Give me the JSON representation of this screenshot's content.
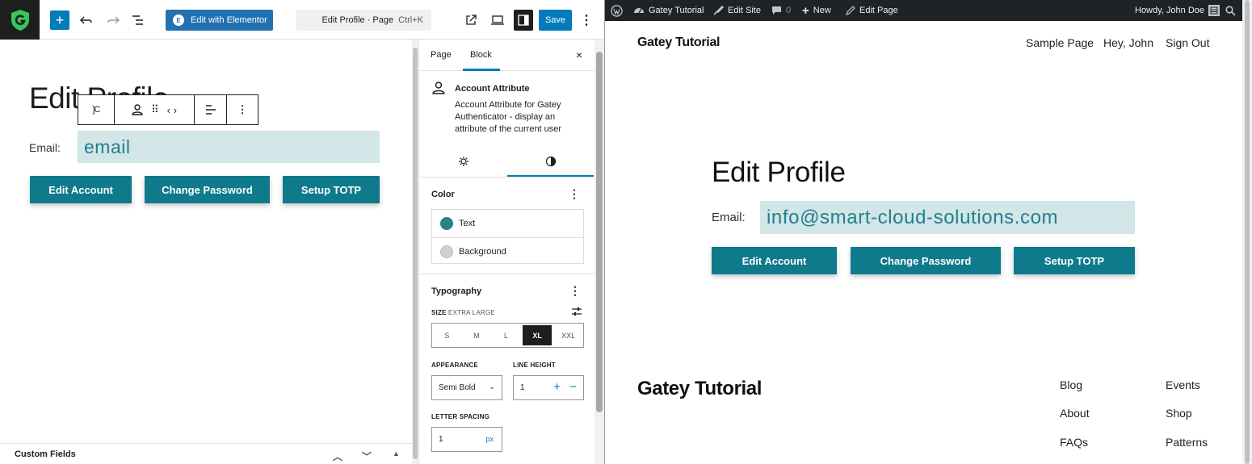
{
  "editor": {
    "toolbar": {
      "inserter_icon": "plus-icon",
      "undo_icon": "undo-icon",
      "redo_icon": "redo-icon",
      "list_view_icon": "list-view-icon",
      "elementor_badge": "E",
      "elementor_label": "Edit with Elementor",
      "command_label": "Edit Profile · Page",
      "command_shortcut": "Ctrl+K",
      "view_icon": "external-link-icon",
      "device_icon": "desktop-icon",
      "settings_icon": "sidebar-toggle-icon",
      "save_label": "Save",
      "options_icon": "kebab-icon"
    },
    "canvas": {
      "title": "Edit Profile",
      "email_label": "Email:",
      "email_value": "email",
      "buttons": [
        "Edit Account",
        "Change Password",
        "Setup TOTP"
      ]
    },
    "custom_fields_label": "Custom Fields"
  },
  "sidebar": {
    "tabs": [
      "Page",
      "Block"
    ],
    "active_tab": "Block",
    "close_label": "×",
    "block_card": {
      "title": "Account Attribute",
      "description": "Account Attribute for Gatey Authenticator - display an attribute of the current user"
    },
    "color": {
      "title": "Color",
      "items": [
        {
          "label": "Text",
          "color": "#2d7f8b"
        },
        {
          "label": "Background",
          "color": "#d0d0d0"
        }
      ]
    },
    "typography": {
      "title": "Typography",
      "size_label": "SIZE",
      "size_value_label": "EXTRA LARGE",
      "sizes": [
        "S",
        "M",
        "L",
        "XL",
        "XXL"
      ],
      "active_size": "XL",
      "appearance_label": "APPEARANCE",
      "appearance_value": "Semi Bold",
      "line_height_label": "LINE HEIGHT",
      "line_height_value": "1",
      "letter_spacing_label": "LETTER SPACING",
      "letter_spacing_value": "1",
      "letter_spacing_unit": "px"
    }
  },
  "preview": {
    "adminbar": {
      "site_name": "Gatey Tutorial",
      "edit_site": "Edit Site",
      "comments_count": "0",
      "new_label": "New",
      "edit_page": "Edit Page",
      "howdy": "Howdy, John Doe"
    },
    "header": {
      "site_title": "Gatey Tutorial",
      "nav": [
        "Sample Page",
        "Hey, John",
        "Sign Out"
      ]
    },
    "content": {
      "title": "Edit Profile",
      "email_label": "Email:",
      "email_value": "info@smart-cloud-solutions.com",
      "buttons": [
        "Edit Account",
        "Change Password",
        "Setup TOTP"
      ]
    },
    "footer": {
      "site_title": "Gatey Tutorial",
      "col1": [
        "Blog",
        "About",
        "FAQs"
      ],
      "col2": [
        "Events",
        "Shop",
        "Patterns"
      ]
    }
  }
}
